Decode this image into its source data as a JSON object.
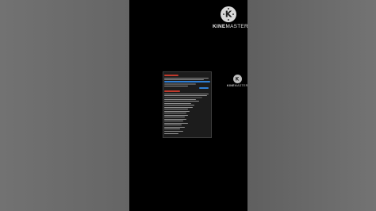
{
  "watermark": {
    "brand_prefix": "KINE",
    "brand_suffix": "MASTER",
    "logo_letter": "K",
    "icon": "kinemaster-logo-icon"
  },
  "colors": {
    "video_background": "#000000",
    "blurred_side": "#6a6a6a",
    "accent_red": "#c0392b",
    "accent_blue": "#2f7fd6"
  }
}
